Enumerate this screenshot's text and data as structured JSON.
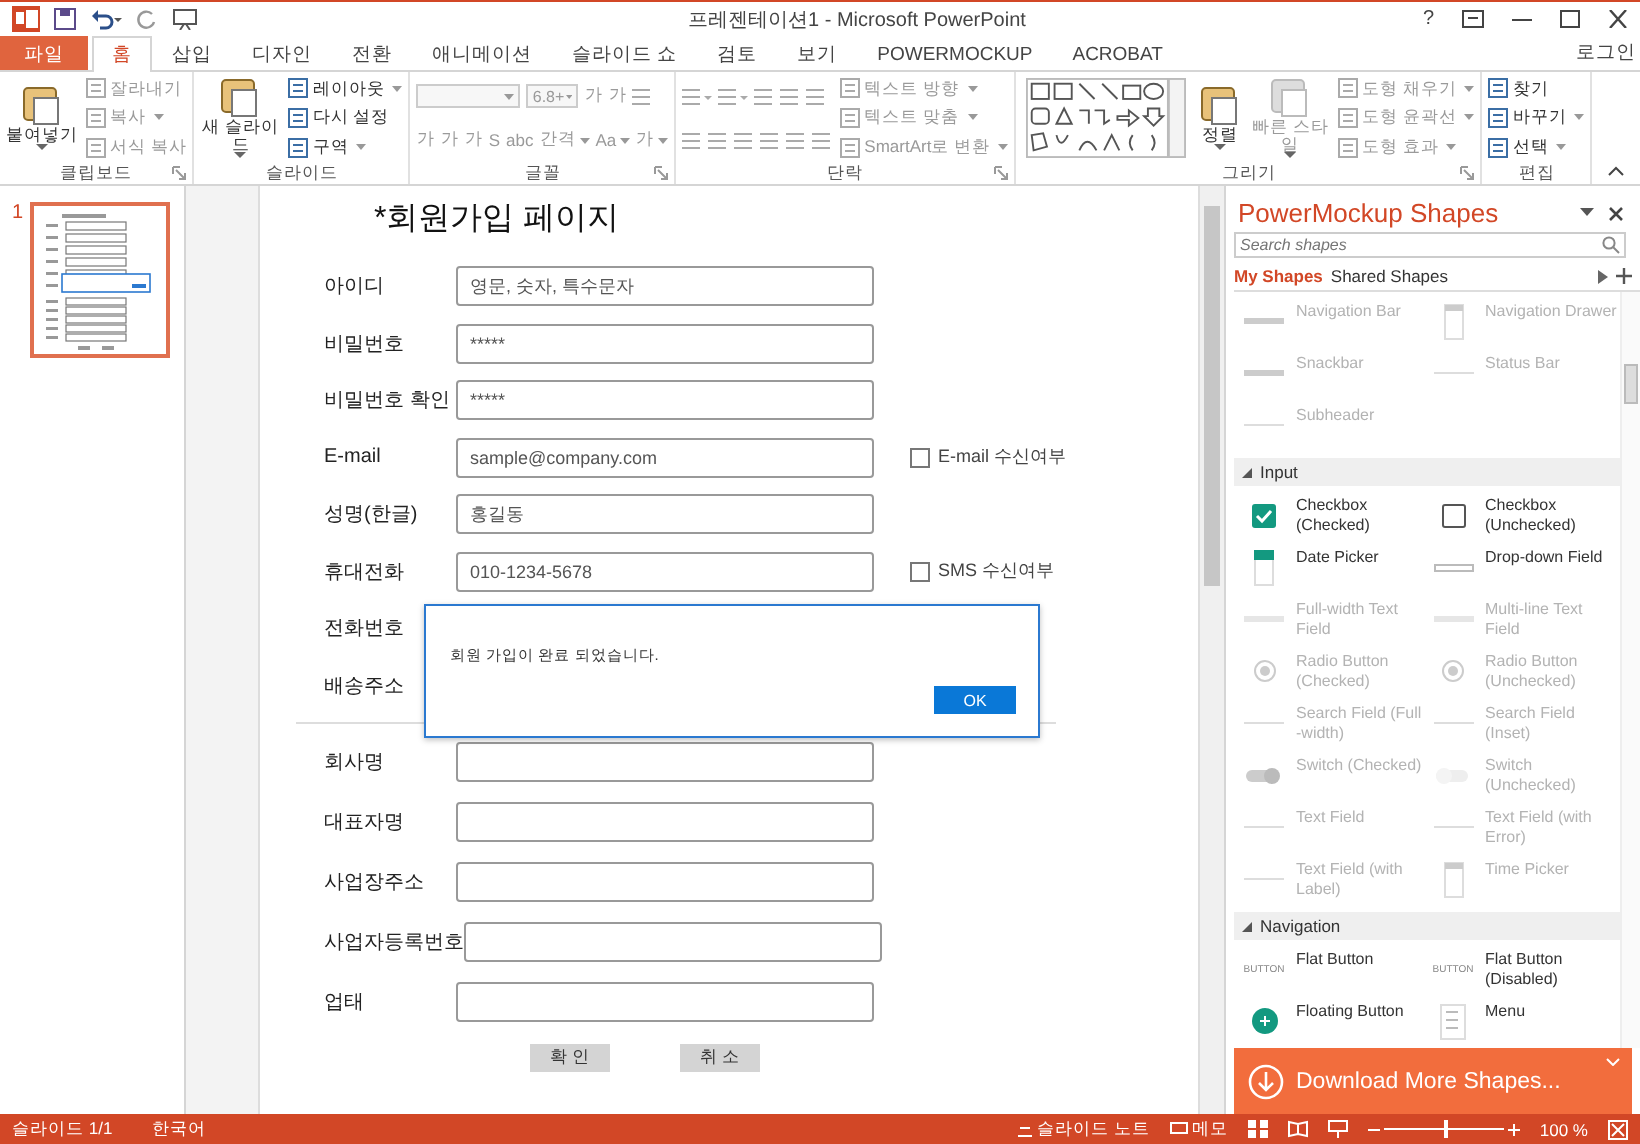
{
  "window": {
    "title": "프레젠테이션1 - Microsoft PowerPoint",
    "controls": [
      "?"
    ]
  },
  "tabs": [
    {
      "label": "파일",
      "kind": "file",
      "selected": false
    },
    {
      "label": "홈",
      "kind": "tab",
      "selected": true
    },
    {
      "label": "삽입",
      "kind": "tab",
      "selected": false
    },
    {
      "label": "디자인",
      "kind": "tab",
      "selected": false
    },
    {
      "label": "전환",
      "kind": "tab",
      "selected": false
    },
    {
      "label": "애니메이션",
      "kind": "tab",
      "selected": false
    },
    {
      "label": "슬라이드 쇼",
      "kind": "tab",
      "selected": false
    },
    {
      "label": "검토",
      "kind": "tab",
      "selected": false
    },
    {
      "label": "보기",
      "kind": "tab",
      "selected": false
    },
    {
      "label": "POWERMOCKUP",
      "kind": "tab",
      "selected": false
    },
    {
      "label": "ACROBAT",
      "kind": "tab",
      "selected": false
    }
  ],
  "account": "로그인",
  "ribbon": [
    {
      "label": "클립보드",
      "launcher": true,
      "columns": [
        [
          [
            {
              "kind": "large",
              "label": "붙여넣기",
              "disabled": false,
              "caret": true
            }
          ]
        ],
        [
          [
            {
              "kind": "small",
              "label": "잘라내기",
              "disabled": true
            }
          ],
          [
            {
              "kind": "small",
              "label": "복사",
              "disabled": true,
              "caret": true
            }
          ],
          [
            {
              "kind": "small",
              "label": "서식 복사",
              "disabled": true
            }
          ]
        ]
      ]
    },
    {
      "label": "슬라이드",
      "launcher": false,
      "columns": [
        [
          [
            {
              "kind": "large",
              "label": "새 슬라이드",
              "disabled": false,
              "caret": true
            }
          ]
        ],
        [
          [
            {
              "kind": "small",
              "label": "레이아웃",
              "disabled": false,
              "caret": true
            }
          ],
          [
            {
              "kind": "small",
              "label": "다시 설정",
              "disabled": false
            }
          ],
          [
            {
              "kind": "small",
              "label": "구역",
              "disabled": false,
              "caret": true
            }
          ]
        ]
      ]
    },
    {
      "label": "글꼴",
      "launcher": true,
      "columns": [
        [
          [
            {
              "kind": "combo",
              "disabled": true
            },
            {
              "kind": "combo",
              "label": "6.8+",
              "disabled": true
            },
            {
              "kind": "text",
              "label": "가",
              "disabled": true
            },
            {
              "kind": "text",
              "label": "가",
              "disabled": true
            },
            {
              "kind": "icon",
              "disabled": true
            }
          ],
          [
            {
              "kind": "text",
              "label": "가",
              "disabled": true
            },
            {
              "kind": "text",
              "label": "가",
              "disabled": true
            },
            {
              "kind": "text",
              "label": "가",
              "disabled": true
            },
            {
              "kind": "text",
              "label": "S",
              "disabled": true
            },
            {
              "kind": "text",
              "label": "abc",
              "disabled": true
            },
            {
              "kind": "text",
              "label": "간격",
              "disabled": true,
              "caret": true
            },
            {
              "kind": "text",
              "label": "Aa",
              "disabled": true,
              "caret": true
            },
            {
              "kind": "text",
              "label": "가",
              "disabled": true,
              "caret": true
            }
          ]
        ]
      ]
    },
    {
      "label": "단락",
      "launcher": true,
      "columns": [
        [
          [
            {
              "kind": "icon",
              "disabled": true,
              "caret": true
            },
            {
              "kind": "icon",
              "disabled": true,
              "caret": true
            },
            {
              "kind": "icon",
              "disabled": true
            },
            {
              "kind": "icon",
              "disabled": true
            },
            {
              "kind": "icon",
              "disabled": true
            }
          ],
          [
            {
              "kind": "icon",
              "disabled": true
            },
            {
              "kind": "icon",
              "disabled": true
            },
            {
              "kind": "icon",
              "disabled": true
            },
            {
              "kind": "icon",
              "disabled": true
            },
            {
              "kind": "icon",
              "disabled": true
            },
            {
              "kind": "icon",
              "disabled": true
            }
          ]
        ],
        [
          [
            {
              "kind": "small",
              "label": "텍스트 방향",
              "disabled": true,
              "caret": true
            }
          ],
          [
            {
              "kind": "small",
              "label": "텍스트 맞춤",
              "disabled": true,
              "caret": true
            }
          ],
          [
            {
              "kind": "small",
              "label": "SmartArt로 변환",
              "disabled": true,
              "caret": true
            }
          ]
        ]
      ]
    },
    {
      "label": "그리기",
      "launcher": true,
      "columns": [
        [
          [
            {
              "kind": "gallery",
              "disabled": false
            }
          ]
        ],
        [
          [
            {
              "kind": "large",
              "label": "정렬",
              "disabled": false,
              "caret": true
            }
          ]
        ],
        [
          [
            {
              "kind": "large",
              "label": "빠른 스타일",
              "disabled": true,
              "caret": true
            }
          ]
        ],
        [
          [
            {
              "kind": "small",
              "label": "도형 채우기",
              "disabled": true,
              "caret": true
            }
          ],
          [
            {
              "kind": "small",
              "label": "도형 윤곽선",
              "disabled": true,
              "caret": true
            }
          ],
          [
            {
              "kind": "small",
              "label": "도형 효과",
              "disabled": true,
              "caret": true
            }
          ]
        ]
      ]
    },
    {
      "label": "편집",
      "launcher": false,
      "columns": [
        [
          [
            {
              "kind": "small",
              "label": "찾기",
              "disabled": false
            }
          ],
          [
            {
              "kind": "small",
              "label": "바꾸기",
              "disabled": false,
              "caret": true
            }
          ],
          [
            {
              "kind": "small",
              "label": "선택",
              "disabled": false,
              "caret": true
            }
          ]
        ]
      ]
    }
  ],
  "thumbnails": [
    {
      "number": "1",
      "selected": true
    }
  ],
  "slide": {
    "title": "*회원가입 페이지",
    "rows": [
      {
        "label": "아이디",
        "value": "영문, 숫자, 특수문자"
      },
      {
        "label": "비밀번호",
        "value": "*****"
      },
      {
        "label": "비밀번호 확인",
        "value": "*****"
      },
      {
        "label": "E-mail",
        "value": "sample@company.com",
        "option": {
          "label": "E-mail 수신여부",
          "checked": false
        }
      },
      {
        "label": "성명(한글)",
        "value": "홍길동"
      },
      {
        "label": "휴대전화",
        "value": "010-1234-5678",
        "option": {
          "label": "SMS 수신여부",
          "checked": false
        }
      },
      {
        "label": "전화번호"
      },
      {
        "label": "배송주소"
      }
    ],
    "business_rows": [
      {
        "label": "회사명"
      },
      {
        "label": "대표자명"
      },
      {
        "label": "사업장주소"
      },
      {
        "label": "사업자등록번호"
      },
      {
        "label": "업태"
      }
    ],
    "buttons": [
      "확 인",
      "취 소"
    ],
    "dialog": {
      "message": "회원 가입이 완료 되었습니다.",
      "button": "OK"
    }
  },
  "panel": {
    "title": "PowerMockup Shapes",
    "search": {
      "placeholder": "Search shapes"
    },
    "tabs": [
      {
        "label": "My Shapes",
        "selected": true
      },
      {
        "label": "Shared Shapes",
        "selected": false
      }
    ],
    "sections": [
      {
        "items": [
          {
            "label": "Navigation Bar",
            "kind": "bar",
            "disabled": true
          },
          {
            "label": "Navigation Drawer",
            "kind": "drawer",
            "disabled": true
          },
          {
            "label": "Snackbar",
            "kind": "bar",
            "disabled": true
          },
          {
            "label": "Status Bar",
            "kind": "thin",
            "disabled": true
          },
          {
            "label": "Subheader",
            "kind": "thin",
            "disabled": true
          }
        ]
      },
      {
        "title": "Input",
        "expanded": true,
        "items": [
          {
            "label": "Checkbox (Checked)",
            "kind": "checkbox-on",
            "disabled": false
          },
          {
            "label": "Checkbox (Unchecked)",
            "kind": "checkbox-off",
            "disabled": false
          },
          {
            "label": "Date Picker",
            "kind": "date",
            "disabled": false
          },
          {
            "label": "Drop-down Field",
            "kind": "dropdown",
            "disabled": false
          },
          {
            "label": "Full-width Text Field",
            "kind": "field",
            "disabled": true
          },
          {
            "label": "Multi-line Text Field",
            "kind": "field",
            "disabled": true
          },
          {
            "label": "Radio Button (Checked)",
            "kind": "radio",
            "disabled": true
          },
          {
            "label": "Radio Button (Unchecked)",
            "kind": "radio",
            "disabled": true
          },
          {
            "label": "Search Field (Full -width)",
            "kind": "thin",
            "disabled": true
          },
          {
            "label": "Search Field (Inset)",
            "kind": "thin",
            "disabled": true
          },
          {
            "label": "Switch (Checked)",
            "kind": "switch-on",
            "disabled": true
          },
          {
            "label": "Switch (Unchecked)",
            "kind": "switch-off",
            "disabled": true
          },
          {
            "label": "Text Field",
            "kind": "thin",
            "disabled": true
          },
          {
            "label": "Text Field (with Error)",
            "kind": "thin",
            "disabled": true
          },
          {
            "label": "Text Field (with Label)",
            "kind": "thin",
            "disabled": true
          },
          {
            "label": "Time Picker",
            "kind": "drawer",
            "disabled": true
          }
        ]
      },
      {
        "title": "Navigation",
        "expanded": true,
        "items": [
          {
            "label": "Flat Button",
            "kind": "flat",
            "icon_text": "BUTTON",
            "disabled": false
          },
          {
            "label": "Flat Button (Disabled)",
            "kind": "flat",
            "icon_text": "BUTTON",
            "disabled": false
          },
          {
            "label": "Floating Button",
            "kind": "fab",
            "disabled": false
          },
          {
            "label": "Menu",
            "kind": "menu",
            "disabled": false
          }
        ]
      }
    ],
    "download": "Download More Shapes..."
  },
  "status_bar": {
    "slide": "슬라이드 1/1",
    "language": "한국어",
    "notes": "슬라이드 노트",
    "comments": "메모",
    "zoom": {
      "level": 0.5,
      "reading": "100 %"
    }
  }
}
